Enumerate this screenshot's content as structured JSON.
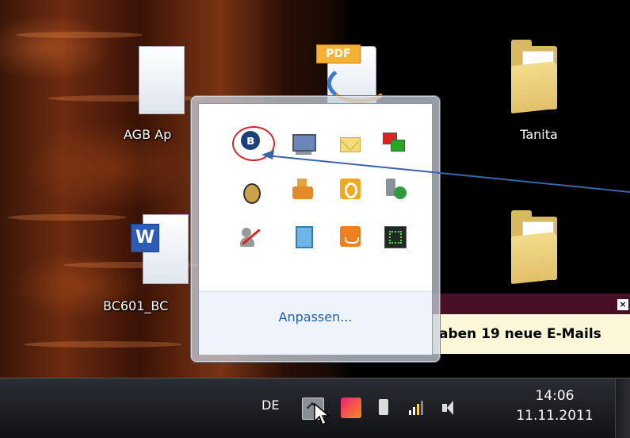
{
  "desktop": {
    "icons": [
      {
        "label": "AGB Ap",
        "type": "document"
      },
      {
        "label": "",
        "type": "pdf",
        "badge": "PDF"
      },
      {
        "label": "Tanita",
        "type": "folder"
      },
      {
        "label": "BC601_BC",
        "type": "word-document",
        "badge": "W"
      },
      {
        "label": "",
        "type": "folder"
      }
    ]
  },
  "tray_popup": {
    "icons": [
      "bluetooth-icon",
      "network-monitor-icon",
      "mail-icon",
      "network-status-icon",
      "bug-icon",
      "weight-icon",
      "office-icon",
      "usb-safe-remove-icon",
      "people-icon",
      "display-icon",
      "java-icon",
      "graphics-icon"
    ],
    "customize_label": "Anpassen..."
  },
  "notification": {
    "text": "aben 19 neue E-Mails",
    "close_label": "×"
  },
  "taskbar": {
    "language": "DE",
    "time": "14:06",
    "date": "11.11.2011"
  },
  "colors": {
    "highlight_circle": "#cf2a2a",
    "arrow": "#3a63a8",
    "link": "#1f5fa8"
  }
}
